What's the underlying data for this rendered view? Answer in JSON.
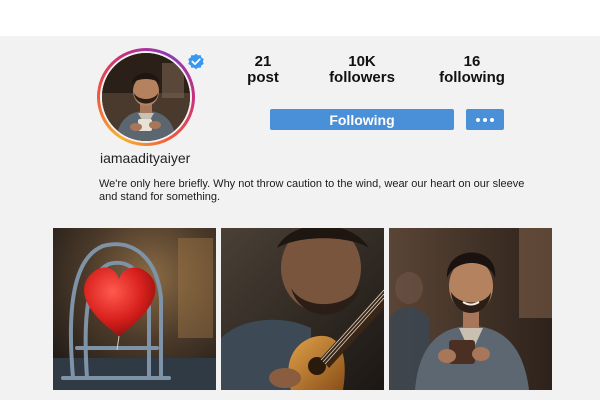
{
  "profile": {
    "username": "iamaadityaiyer",
    "verified": true,
    "bio": "We're only here briefly. Why not throw caution to the wind, wear our heart on our sleeve and stand for something."
  },
  "stats": [
    {
      "value": "21",
      "label": "post"
    },
    {
      "value": "10K",
      "label": "followers"
    },
    {
      "value": "16",
      "label": "following"
    }
  ],
  "actions": {
    "following_label": "Following",
    "more_icon": "more-horizontal-icon"
  },
  "colors": {
    "accent": "#4a90d9",
    "verified": "#3897f0",
    "panel_bg": "#f2f2f2"
  },
  "posts": [
    {
      "name": "heart-balloon-on-chair"
    },
    {
      "name": "man-playing-guitar"
    },
    {
      "name": "man-holding-coffee-cup"
    }
  ]
}
